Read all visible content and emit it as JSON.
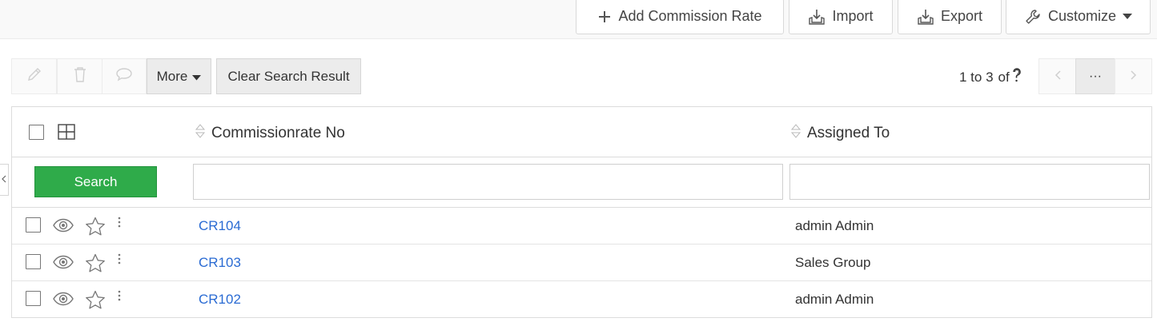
{
  "topbar": {
    "add_label": "Add Commission Rate",
    "import_label": "Import",
    "export_label": "Export",
    "customize_label": "Customize"
  },
  "toolbar": {
    "more_label": "More",
    "clear_label": "Clear Search Result"
  },
  "pager": {
    "range": "1 to 3",
    "of": "of",
    "dots": "···"
  },
  "table": {
    "columns": [
      "Commissionrate No",
      "Assigned To"
    ],
    "search_label": "Search",
    "rows": [
      {
        "no": "CR104",
        "assigned": "admin Admin"
      },
      {
        "no": "CR103",
        "assigned": "Sales Group"
      },
      {
        "no": "CR102",
        "assigned": "admin Admin"
      }
    ]
  },
  "colors": {
    "accent_green": "#2fab4a",
    "link_blue": "#2a6bd3"
  }
}
